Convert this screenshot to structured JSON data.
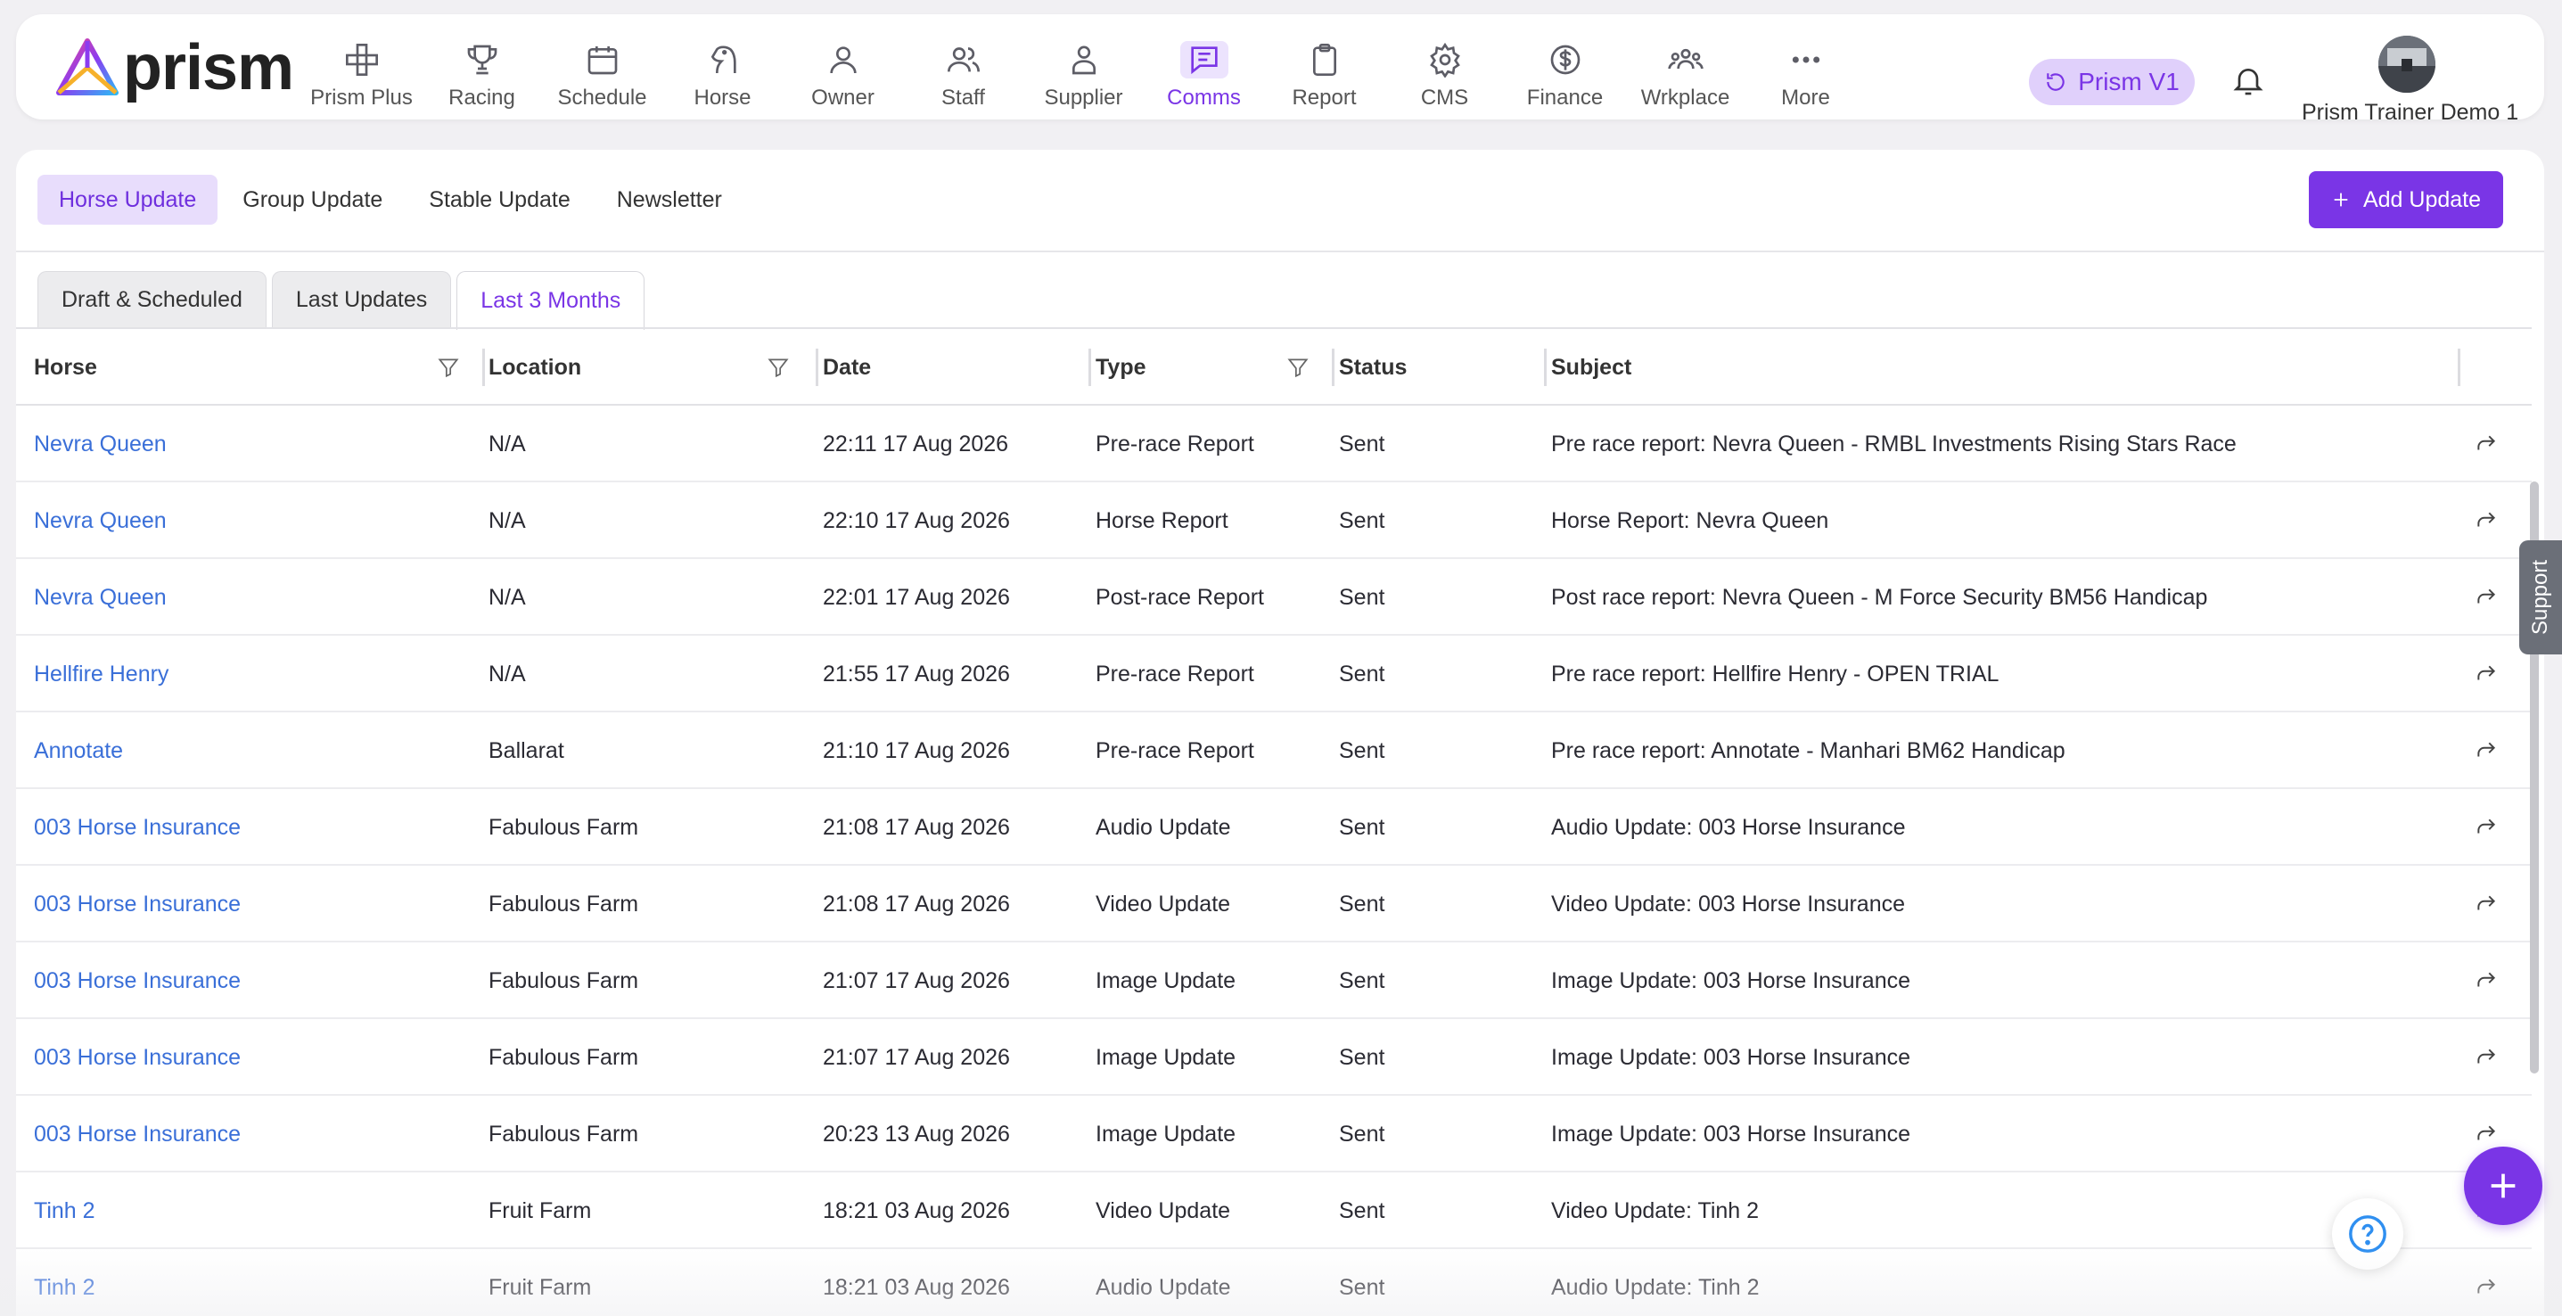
{
  "brand": {
    "name": "prism"
  },
  "nav": [
    {
      "id": "prism-plus",
      "label": "Prism Plus",
      "icon": "grid-cross-icon"
    },
    {
      "id": "racing",
      "label": "Racing",
      "icon": "trophy-icon"
    },
    {
      "id": "schedule",
      "label": "Schedule",
      "icon": "calendar-icon"
    },
    {
      "id": "horse",
      "label": "Horse",
      "icon": "horse-head-icon"
    },
    {
      "id": "owner",
      "label": "Owner",
      "icon": "user-icon"
    },
    {
      "id": "staff",
      "label": "Staff",
      "icon": "users-icon"
    },
    {
      "id": "supplier",
      "label": "Supplier",
      "icon": "person-badge-icon"
    },
    {
      "id": "comms",
      "label": "Comms",
      "icon": "message-icon",
      "active": true
    },
    {
      "id": "report",
      "label": "Report",
      "icon": "clipboard-icon"
    },
    {
      "id": "cms",
      "label": "CMS",
      "icon": "gear-icon"
    },
    {
      "id": "finance",
      "label": "Finance",
      "icon": "dollar-circle-icon"
    },
    {
      "id": "wrkplace",
      "label": "Wrkplace",
      "icon": "group-icon"
    },
    {
      "id": "more",
      "label": "More",
      "icon": "dots-icon"
    }
  ],
  "header": {
    "version_label": "Prism V1",
    "user_name": "Prism Trainer Demo 1"
  },
  "subtabs": [
    "Horse Update",
    "Group Update",
    "Stable Update",
    "Newsletter"
  ],
  "active_subtab": "Horse Update",
  "add_button": "Add Update",
  "view_tabs": [
    "Draft & Scheduled",
    "Last Updates",
    "Last 3 Months"
  ],
  "active_view_tab": "Last 3 Months",
  "table": {
    "columns": [
      "Horse",
      "Location",
      "Date",
      "Type",
      "Status",
      "Subject"
    ],
    "rows": [
      {
        "horse": "Nevra Queen",
        "location": "N/A",
        "date": "22:11 17 Aug 2026",
        "type": "Pre-race Report",
        "status": "Sent",
        "subject": "Pre race report: Nevra Queen - RMBL Investments Rising Stars Race"
      },
      {
        "horse": "Nevra Queen",
        "location": "N/A",
        "date": "22:10 17 Aug 2026",
        "type": "Horse Report",
        "status": "Sent",
        "subject": "Horse Report: Nevra Queen"
      },
      {
        "horse": "Nevra Queen",
        "location": "N/A",
        "date": "22:01 17 Aug 2026",
        "type": "Post-race Report",
        "status": "Sent",
        "subject": "Post race report: Nevra Queen - M Force Security BM56 Handicap"
      },
      {
        "horse": "Hellfire Henry",
        "location": "N/A",
        "date": "21:55 17 Aug 2026",
        "type": "Pre-race Report",
        "status": "Sent",
        "subject": "Pre race report: Hellfire Henry - OPEN TRIAL"
      },
      {
        "horse": "Annotate",
        "location": "Ballarat",
        "date": "21:10 17 Aug 2026",
        "type": "Pre-race Report",
        "status": "Sent",
        "subject": "Pre race report: Annotate - Manhari BM62 Handicap"
      },
      {
        "horse": "003 Horse Insurance",
        "location": "Fabulous Farm",
        "date": "21:08 17 Aug 2026",
        "type": "Audio Update",
        "status": "Sent",
        "subject": "Audio Update: 003 Horse Insurance"
      },
      {
        "horse": "003 Horse Insurance",
        "location": "Fabulous Farm",
        "date": "21:08 17 Aug 2026",
        "type": "Video Update",
        "status": "Sent",
        "subject": "Video Update: 003 Horse Insurance"
      },
      {
        "horse": "003 Horse Insurance",
        "location": "Fabulous Farm",
        "date": "21:07 17 Aug 2026",
        "type": "Image Update",
        "status": "Sent",
        "subject": "Image Update: 003 Horse Insurance"
      },
      {
        "horse": "003 Horse Insurance",
        "location": "Fabulous Farm",
        "date": "21:07 17 Aug 2026",
        "type": "Image Update",
        "status": "Sent",
        "subject": "Image Update: 003 Horse Insurance"
      },
      {
        "horse": "003 Horse Insurance",
        "location": "Fabulous Farm",
        "date": "20:23 13 Aug 2026",
        "type": "Image Update",
        "status": "Sent",
        "subject": "Image Update: 003 Horse Insurance"
      },
      {
        "horse": "Tinh 2",
        "location": "Fruit Farm",
        "date": "18:21 03 Aug 2026",
        "type": "Video Update",
        "status": "Sent",
        "subject": "Video Update: Tinh 2"
      },
      {
        "horse": "Tinh 2",
        "location": "Fruit Farm",
        "date": "18:21 03 Aug 2026",
        "type": "Audio Update",
        "status": "Sent",
        "subject": "Audio Update: Tinh 2"
      }
    ]
  },
  "support_label": "Support",
  "colors": {
    "accent": "#7a35e6",
    "link": "#3a6fd8",
    "pill_bg": "#e0d0fb"
  }
}
